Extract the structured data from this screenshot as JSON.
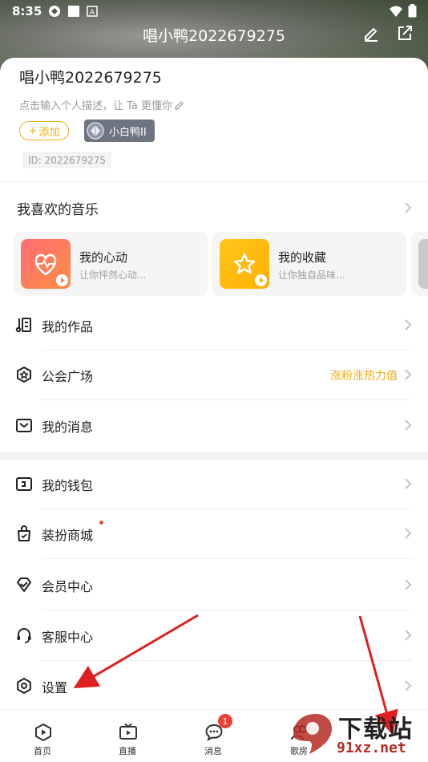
{
  "status_bar": {
    "time": "8:35",
    "icons": [
      "signal-app-icon",
      "square-icon",
      "text-app-icon"
    ],
    "right_icons": [
      "wifi-icon",
      "battery-icon"
    ]
  },
  "header": {
    "title": "唱小鸭2022679275",
    "edit_icon": "edit-icon",
    "share_icon": "share-icon"
  },
  "profile": {
    "username": "唱小鸭2022679275",
    "description": "点击输入个人描述，让 Ta 更懂你",
    "add_label": "添加",
    "add_prefix": "+",
    "badge_label": "小白鸭II",
    "id_label": "ID: 2022679275"
  },
  "music": {
    "section_title": "我喜欢的音乐",
    "cards": [
      {
        "name": "我的心动",
        "sub": "让你怦然心动...",
        "color_start": "#ff6a6a",
        "color_end": "#ff8c44"
      },
      {
        "name": "我的收藏",
        "sub": "让你独自品味...",
        "color_start": "#ffc21a",
        "color_end": "#ffb300"
      }
    ]
  },
  "menu_group1": [
    {
      "label": "我的作品",
      "icon": "music-note-icon",
      "extra": ""
    },
    {
      "label": "公会广场",
      "icon": "guild-icon",
      "extra": "涨粉涨热力值"
    },
    {
      "label": "我的消息",
      "icon": "message-icon",
      "extra": ""
    }
  ],
  "menu_group2": [
    {
      "label": "我的钱包",
      "icon": "wallet-icon",
      "dot": false
    },
    {
      "label": "装扮商城",
      "icon": "shop-icon",
      "dot": true
    },
    {
      "label": "会员中心",
      "icon": "vip-icon",
      "dot": false
    },
    {
      "label": "客服中心",
      "icon": "headset-icon",
      "dot": false
    },
    {
      "label": "设置",
      "icon": "settings-icon",
      "dot": false
    }
  ],
  "bottom_nav": [
    {
      "label": "首页",
      "icon": "home-play-icon"
    },
    {
      "label": "直播",
      "icon": "live-tv-icon"
    },
    {
      "label": "消息",
      "icon": "chat-icon",
      "badge": "1"
    },
    {
      "label": "歌房",
      "icon": "people-icon"
    }
  ],
  "watermark": {
    "line1": "下载站",
    "line2": "91xz.net"
  },
  "colors": {
    "accent": "#f2ad1c",
    "red": "#e8423a",
    "annotation_arrow": "#e02020"
  }
}
